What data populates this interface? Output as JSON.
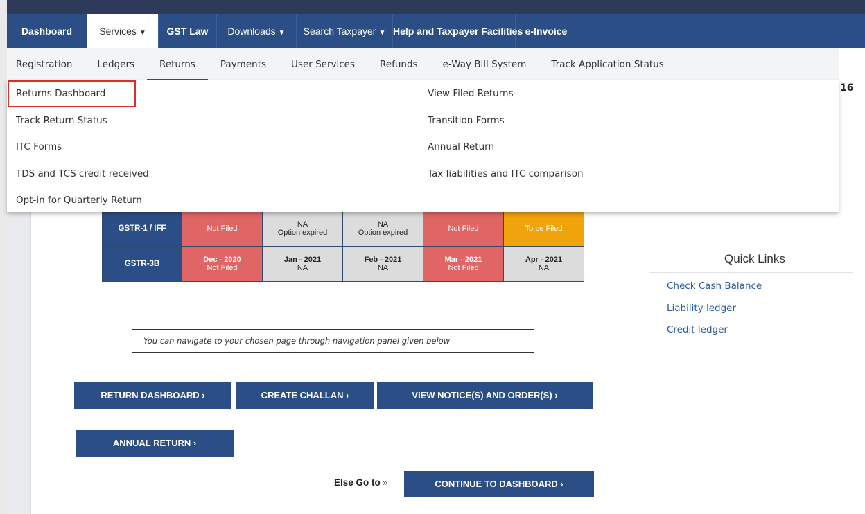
{
  "main_nav": [
    {
      "label": "Dashboard",
      "caret": false,
      "active": false
    },
    {
      "label": "Services",
      "caret": true,
      "active": true
    },
    {
      "label": "GST Law",
      "caret": false,
      "active": false
    },
    {
      "label": "Downloads",
      "caret": true,
      "active": false
    },
    {
      "label": "Search Taxpayer",
      "caret": true,
      "active": false
    },
    {
      "label": "Help and Taxpayer Facilities",
      "caret": false,
      "active": false
    },
    {
      "label": "e-Invoice",
      "caret": false,
      "active": false
    }
  ],
  "sub_nav": [
    "Registration",
    "Ledgers",
    "Returns",
    "Payments",
    "User Services",
    "Refunds",
    "e-Way Bill System",
    "Track Application Status"
  ],
  "sub_nav_active": "Returns",
  "returns_menu": {
    "left": [
      "Returns Dashboard",
      "Track Return Status",
      "ITC Forms",
      "TDS and TCS credit received",
      "Opt-in for Quarterly Return"
    ],
    "right": [
      "View Filed Returns",
      "Transition Forms",
      "Annual Return",
      "Tax liabilities and ITC comparison"
    ],
    "highlighted": "Returns Dashboard"
  },
  "edge_number": "16",
  "return_status_table": {
    "rows": [
      {
        "label": "GSTR-1 / IFF",
        "cells": [
          {
            "period": "",
            "status": "Not Filed",
            "color": "#e06666"
          },
          {
            "period": "",
            "status": "NA",
            "note": "Option expired",
            "color": "#dcdcdc"
          },
          {
            "period": "",
            "status": "NA",
            "note": "Option expired",
            "color": "#dcdcdc"
          },
          {
            "period": "",
            "status": "Not Filed",
            "color": "#e06666"
          },
          {
            "period": "",
            "status": "To be Filed",
            "color": "#f0a30a"
          }
        ]
      },
      {
        "label": "GSTR-3B",
        "cells": [
          {
            "period": "Dec - 2020",
            "status": "Not Filed",
            "color": "#e06666"
          },
          {
            "period": "Jan - 2021",
            "status": "NA",
            "color": "#dcdcdc"
          },
          {
            "period": "Feb - 2021",
            "status": "NA",
            "color": "#dcdcdc"
          },
          {
            "period": "Mar - 2021",
            "status": "Not Filed",
            "color": "#e06666"
          },
          {
            "period": "Apr - 2021",
            "status": "NA",
            "color": "#dcdcdc"
          }
        ]
      }
    ]
  },
  "quick_links": {
    "title": "Quick Links",
    "items": [
      "Check Cash Balance",
      "Liability ledger",
      "Credit ledger"
    ]
  },
  "info_text": "You can navigate to your chosen page through navigation panel given below",
  "buttons": {
    "return_dashboard": "RETURN DASHBOARD ›",
    "create_challan": "CREATE CHALLAN ›",
    "view_notices": "VIEW NOTICE(S) AND ORDER(S) ›",
    "annual_return": "ANNUAL RETURN ›",
    "continue_dashboard": "CONTINUE TO DASHBOARD ›"
  },
  "else_go_to": "Else Go to",
  "else_go_arrows": "»",
  "colors": {
    "primary": "#2c4e86",
    "not_filed": "#e06666",
    "na": "#dcdcdc",
    "to_be_filed": "#f0a30a",
    "highlight_border": "#e02b2b"
  }
}
